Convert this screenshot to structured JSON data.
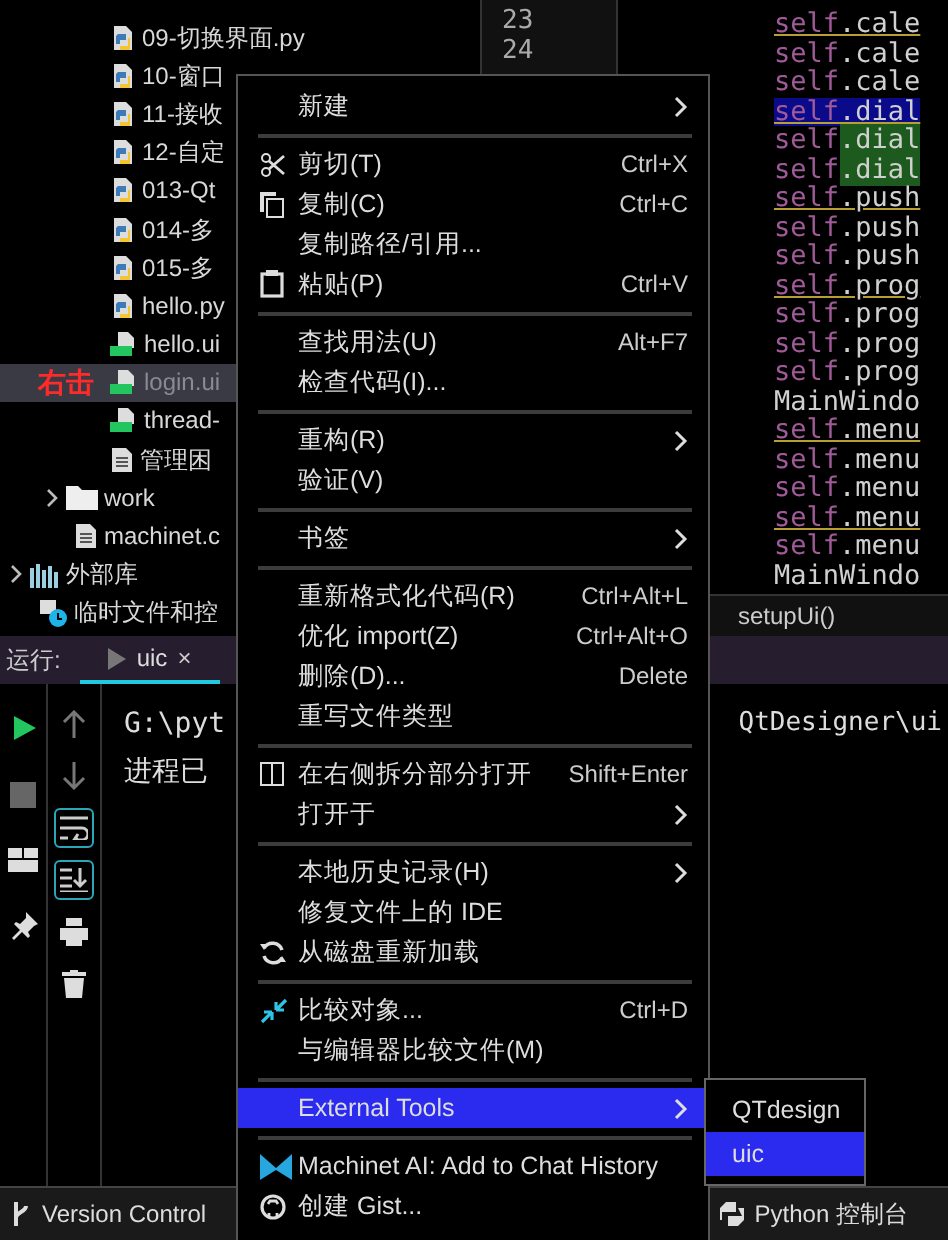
{
  "project_tree": [
    {
      "children": [
        {
          "children": [
            {
              "label": "09-切换界面.py",
              "kind": "py",
              "selected": false
            },
            {
              "label": "10-窗口",
              "kind": "py",
              "selected": false
            },
            {
              "label": "11-接收",
              "kind": "py",
              "selected": false
            },
            {
              "label": "12-自定",
              "kind": "py",
              "selected": false
            },
            {
              "label": "013-Qt",
              "kind": "py",
              "selected": false
            },
            {
              "label": "014-多",
              "kind": "py",
              "selected": false
            },
            {
              "label": "015-多",
              "kind": "py",
              "selected": false
            },
            {
              "label": "hello.py",
              "kind": "py",
              "selected": false
            },
            {
              "label": "hello.ui",
              "kind": "ui",
              "selected": false
            },
            {
              "label": "login.ui",
              "kind": "ui",
              "selected": true,
              "annotation": "右击"
            },
            {
              "label": "thread-",
              "kind": "ui",
              "selected": false
            },
            {
              "label": "管理困",
              "kind": "doc",
              "selected": false
            }
          ]
        },
        {
          "label": "work",
          "kind": "folder",
          "expanded": false,
          "selected": false
        },
        {
          "label": "machinet.c",
          "kind": "doc",
          "selected": false
        }
      ]
    },
    {
      "label": "外部库",
      "kind": "library",
      "expanded": false,
      "selected": false
    },
    {
      "label": "临时文件和控",
      "kind": "scratch",
      "selected": false
    }
  ],
  "editor": {
    "line_numbers": [
      "23",
      "24"
    ],
    "lines": [
      {
        "text": "self.cale",
        "warning": true,
        "selected": false,
        "match": false
      },
      {
        "text": "self.cale",
        "warning": false,
        "selected": false,
        "match": false
      },
      {
        "text": "self.cale",
        "warning": false,
        "selected": false,
        "match": false
      },
      {
        "text": "self.dial",
        "warning": true,
        "selected": true,
        "match": false
      },
      {
        "text": "self.dial",
        "warning": false,
        "selected": false,
        "match": true
      },
      {
        "text": "self.dial",
        "warning": false,
        "selected": false,
        "match": true
      },
      {
        "text": "self.push",
        "warning": true,
        "selected": false,
        "match": false
      },
      {
        "text": "self.push",
        "warning": false,
        "selected": false,
        "match": false
      },
      {
        "text": "self.push",
        "warning": false,
        "selected": false,
        "match": false
      },
      {
        "text": "self.prog",
        "warning": true,
        "selected": false,
        "match": false
      },
      {
        "text": "self.prog",
        "warning": false,
        "selected": false,
        "match": false
      },
      {
        "text": "self.prog",
        "warning": false,
        "selected": false,
        "match": false
      },
      {
        "text": "self.prog",
        "warning": false,
        "selected": false,
        "match": false
      },
      {
        "text": "MainWindo",
        "warning": false,
        "selected": false,
        "match": false
      },
      {
        "text": "self.menu",
        "warning": true,
        "selected": false,
        "match": false
      },
      {
        "text": "self.menu",
        "warning": false,
        "selected": false,
        "match": false
      },
      {
        "text": "self.menu",
        "warning": false,
        "selected": false,
        "match": false
      },
      {
        "text": "self.menu",
        "warning": true,
        "selected": false,
        "match": false
      },
      {
        "text": "self.menu",
        "warning": false,
        "selected": false,
        "match": false
      },
      {
        "text": "MainWindo",
        "warning": false,
        "selected": false,
        "match": false
      }
    ],
    "breadcrumb": "setupUi()"
  },
  "run_panel": {
    "label": "运行:",
    "tabs": [
      {
        "label": "uic",
        "close": "×",
        "selected": true
      }
    ],
    "toolbar_left": [
      {
        "kind": "run"
      },
      {
        "kind": "stop"
      },
      {
        "kind": "layout"
      },
      {
        "kind": "pin"
      }
    ],
    "toolbar_right": [
      {
        "kind": "up",
        "on": false
      },
      {
        "kind": "down",
        "on": false
      },
      {
        "kind": "wrap",
        "on": true
      },
      {
        "kind": "scroll-end",
        "on": true
      },
      {
        "kind": "print",
        "on": false
      },
      {
        "kind": "trash",
        "on": false
      }
    ],
    "output": [
      {
        "left": "G:\\pyt",
        "right": "QtDesigner\\ui"
      },
      {
        "left": "进程已"
      }
    ]
  },
  "status_bar": {
    "left": "Version Control",
    "right": "Python 控制台"
  },
  "context_menu": {
    "items": [
      {
        "kind": "item",
        "label": "新建",
        "submenu": true,
        "selected": false
      },
      {
        "kind": "separator"
      },
      {
        "kind": "item",
        "label": "剪切(T)",
        "shortcut": "Ctrl+X",
        "selected": false
      },
      {
        "kind": "item",
        "label": "复制(C)",
        "shortcut": "Ctrl+C",
        "selected": false
      },
      {
        "kind": "item",
        "label": "复制路径/引用...",
        "selected": false
      },
      {
        "kind": "item",
        "label": "粘贴(P)",
        "shortcut": "Ctrl+V",
        "selected": false
      },
      {
        "kind": "separator"
      },
      {
        "kind": "item",
        "label": "查找用法(U)",
        "shortcut": "Alt+F7",
        "selected": false
      },
      {
        "kind": "item",
        "label": "检查代码(I)...",
        "selected": false
      },
      {
        "kind": "separator"
      },
      {
        "kind": "item",
        "label": "重构(R)",
        "submenu": true,
        "selected": false
      },
      {
        "kind": "item",
        "label": "验证(V)",
        "selected": false
      },
      {
        "kind": "separator"
      },
      {
        "kind": "item",
        "label": "书签",
        "submenu": true,
        "selected": false
      },
      {
        "kind": "separator"
      },
      {
        "kind": "item",
        "label": "重新格式化代码(R)",
        "shortcut": "Ctrl+Alt+L",
        "selected": false
      },
      {
        "kind": "item",
        "label": "优化 import(Z)",
        "shortcut": "Ctrl+Alt+O",
        "selected": false
      },
      {
        "kind": "item",
        "label": "删除(D)...",
        "shortcut": "Delete",
        "selected": false
      },
      {
        "kind": "item",
        "label": "重写文件类型",
        "selected": false
      },
      {
        "kind": "separator"
      },
      {
        "kind": "item",
        "label": "在右侧拆分部分打开",
        "shortcut": "Shift+Enter",
        "selected": false
      },
      {
        "kind": "item",
        "label": "打开于",
        "submenu": true,
        "selected": false
      },
      {
        "kind": "separator"
      },
      {
        "kind": "item",
        "label": "本地历史记录(H)",
        "submenu": true,
        "selected": false
      },
      {
        "kind": "item",
        "label": "修复文件上的 IDE",
        "selected": false
      },
      {
        "kind": "item",
        "label": "从磁盘重新加载",
        "selected": false
      },
      {
        "kind": "separator"
      },
      {
        "kind": "item",
        "label": "比较对象...",
        "shortcut": "Ctrl+D",
        "selected": false
      },
      {
        "kind": "item",
        "label": "与编辑器比较文件(M)",
        "selected": false
      },
      {
        "kind": "separator"
      },
      {
        "kind": "item",
        "label": "External Tools",
        "submenu": true,
        "selected": true
      },
      {
        "kind": "separator"
      },
      {
        "kind": "item",
        "label": "Machinet AI: Add to Chat History",
        "selected": false
      },
      {
        "kind": "item",
        "label": "创建 Gist...",
        "selected": false
      }
    ]
  },
  "submenu": {
    "items": [
      {
        "label": "QTdesign",
        "selected": false
      },
      {
        "label": "uic",
        "selected": true
      }
    ]
  }
}
